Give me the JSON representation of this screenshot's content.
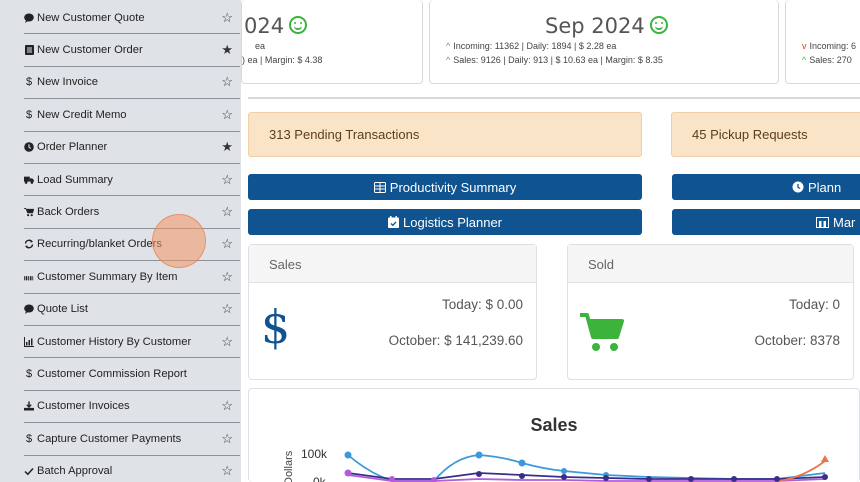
{
  "sidebar": {
    "items": [
      {
        "label": "New Customer Quote",
        "icon": "comment-icon",
        "starred": false
      },
      {
        "label": "New Customer Order",
        "icon": "document-icon",
        "starred": true
      },
      {
        "label": "New Invoice",
        "icon": "dollar-icon",
        "starred": false
      },
      {
        "label": "New Credit Memo",
        "icon": "dollar-icon",
        "starred": false
      },
      {
        "label": "Order Planner",
        "icon": "clock-icon",
        "starred": true
      },
      {
        "label": "Load Summary",
        "icon": "truck-icon",
        "starred": false
      },
      {
        "label": "Back Orders",
        "icon": "cart-icon",
        "starred": false
      },
      {
        "label": "Recurring/blanket Orders",
        "icon": "recycle-icon",
        "starred": false
      },
      {
        "label": "Customer Summary By Item",
        "icon": "barcode-icon",
        "starred": false
      },
      {
        "label": "Quote List",
        "icon": "comment-icon",
        "starred": false
      },
      {
        "label": "Customer History By Customer",
        "icon": "chart-icon",
        "starred": false
      },
      {
        "label": "Customer Commission Report",
        "icon": "dollar-icon",
        "starred": null
      },
      {
        "label": "Customer Invoices",
        "icon": "download-icon",
        "starred": false
      },
      {
        "label": "Capture Customer Payments",
        "icon": "dollar-icon",
        "starred": false
      },
      {
        "label": "Batch Approval",
        "icon": "check-icon",
        "starred": false
      }
    ]
  },
  "stats": {
    "left": {
      "title": "024",
      "line1": "ea",
      "line2": ") ea | Margin: $ 4.38"
    },
    "center": {
      "title": "Sep 2024",
      "incoming": "Incoming: 11362 | Daily: 1894 | $ 2.28 ea",
      "sales": "Sales: 9126 | Daily: 913 | $ 10.63 ea | Margin: $ 8.35"
    },
    "right": {
      "incoming": "Incoming: 6",
      "sales": "Sales: 270"
    }
  },
  "alerts": {
    "pending": "313 Pending Transactions",
    "pickup": "45 Pickup Requests"
  },
  "buttons": {
    "productivity": "Productivity Summary",
    "planner_right": "Plann",
    "logistics": "Logistics Planner",
    "map_right": "Mar"
  },
  "sales_card": {
    "title": "Sales",
    "today": "Today: $ 0.00",
    "month": "October: $ 141,239.60"
  },
  "sold_card": {
    "title": "Sold",
    "today": "Today: 0",
    "month": "October: 8378"
  },
  "chart": {
    "title": "Sales",
    "y_title": "Dollars",
    "y_ticks": [
      "100k",
      "0k"
    ]
  },
  "colors": {
    "accent": "#0f5390",
    "alert_bg": "#fae4c7",
    "sidebar_bg": "#dfe2e7",
    "positive": "#3cb43c",
    "negative": "#d9342b"
  }
}
